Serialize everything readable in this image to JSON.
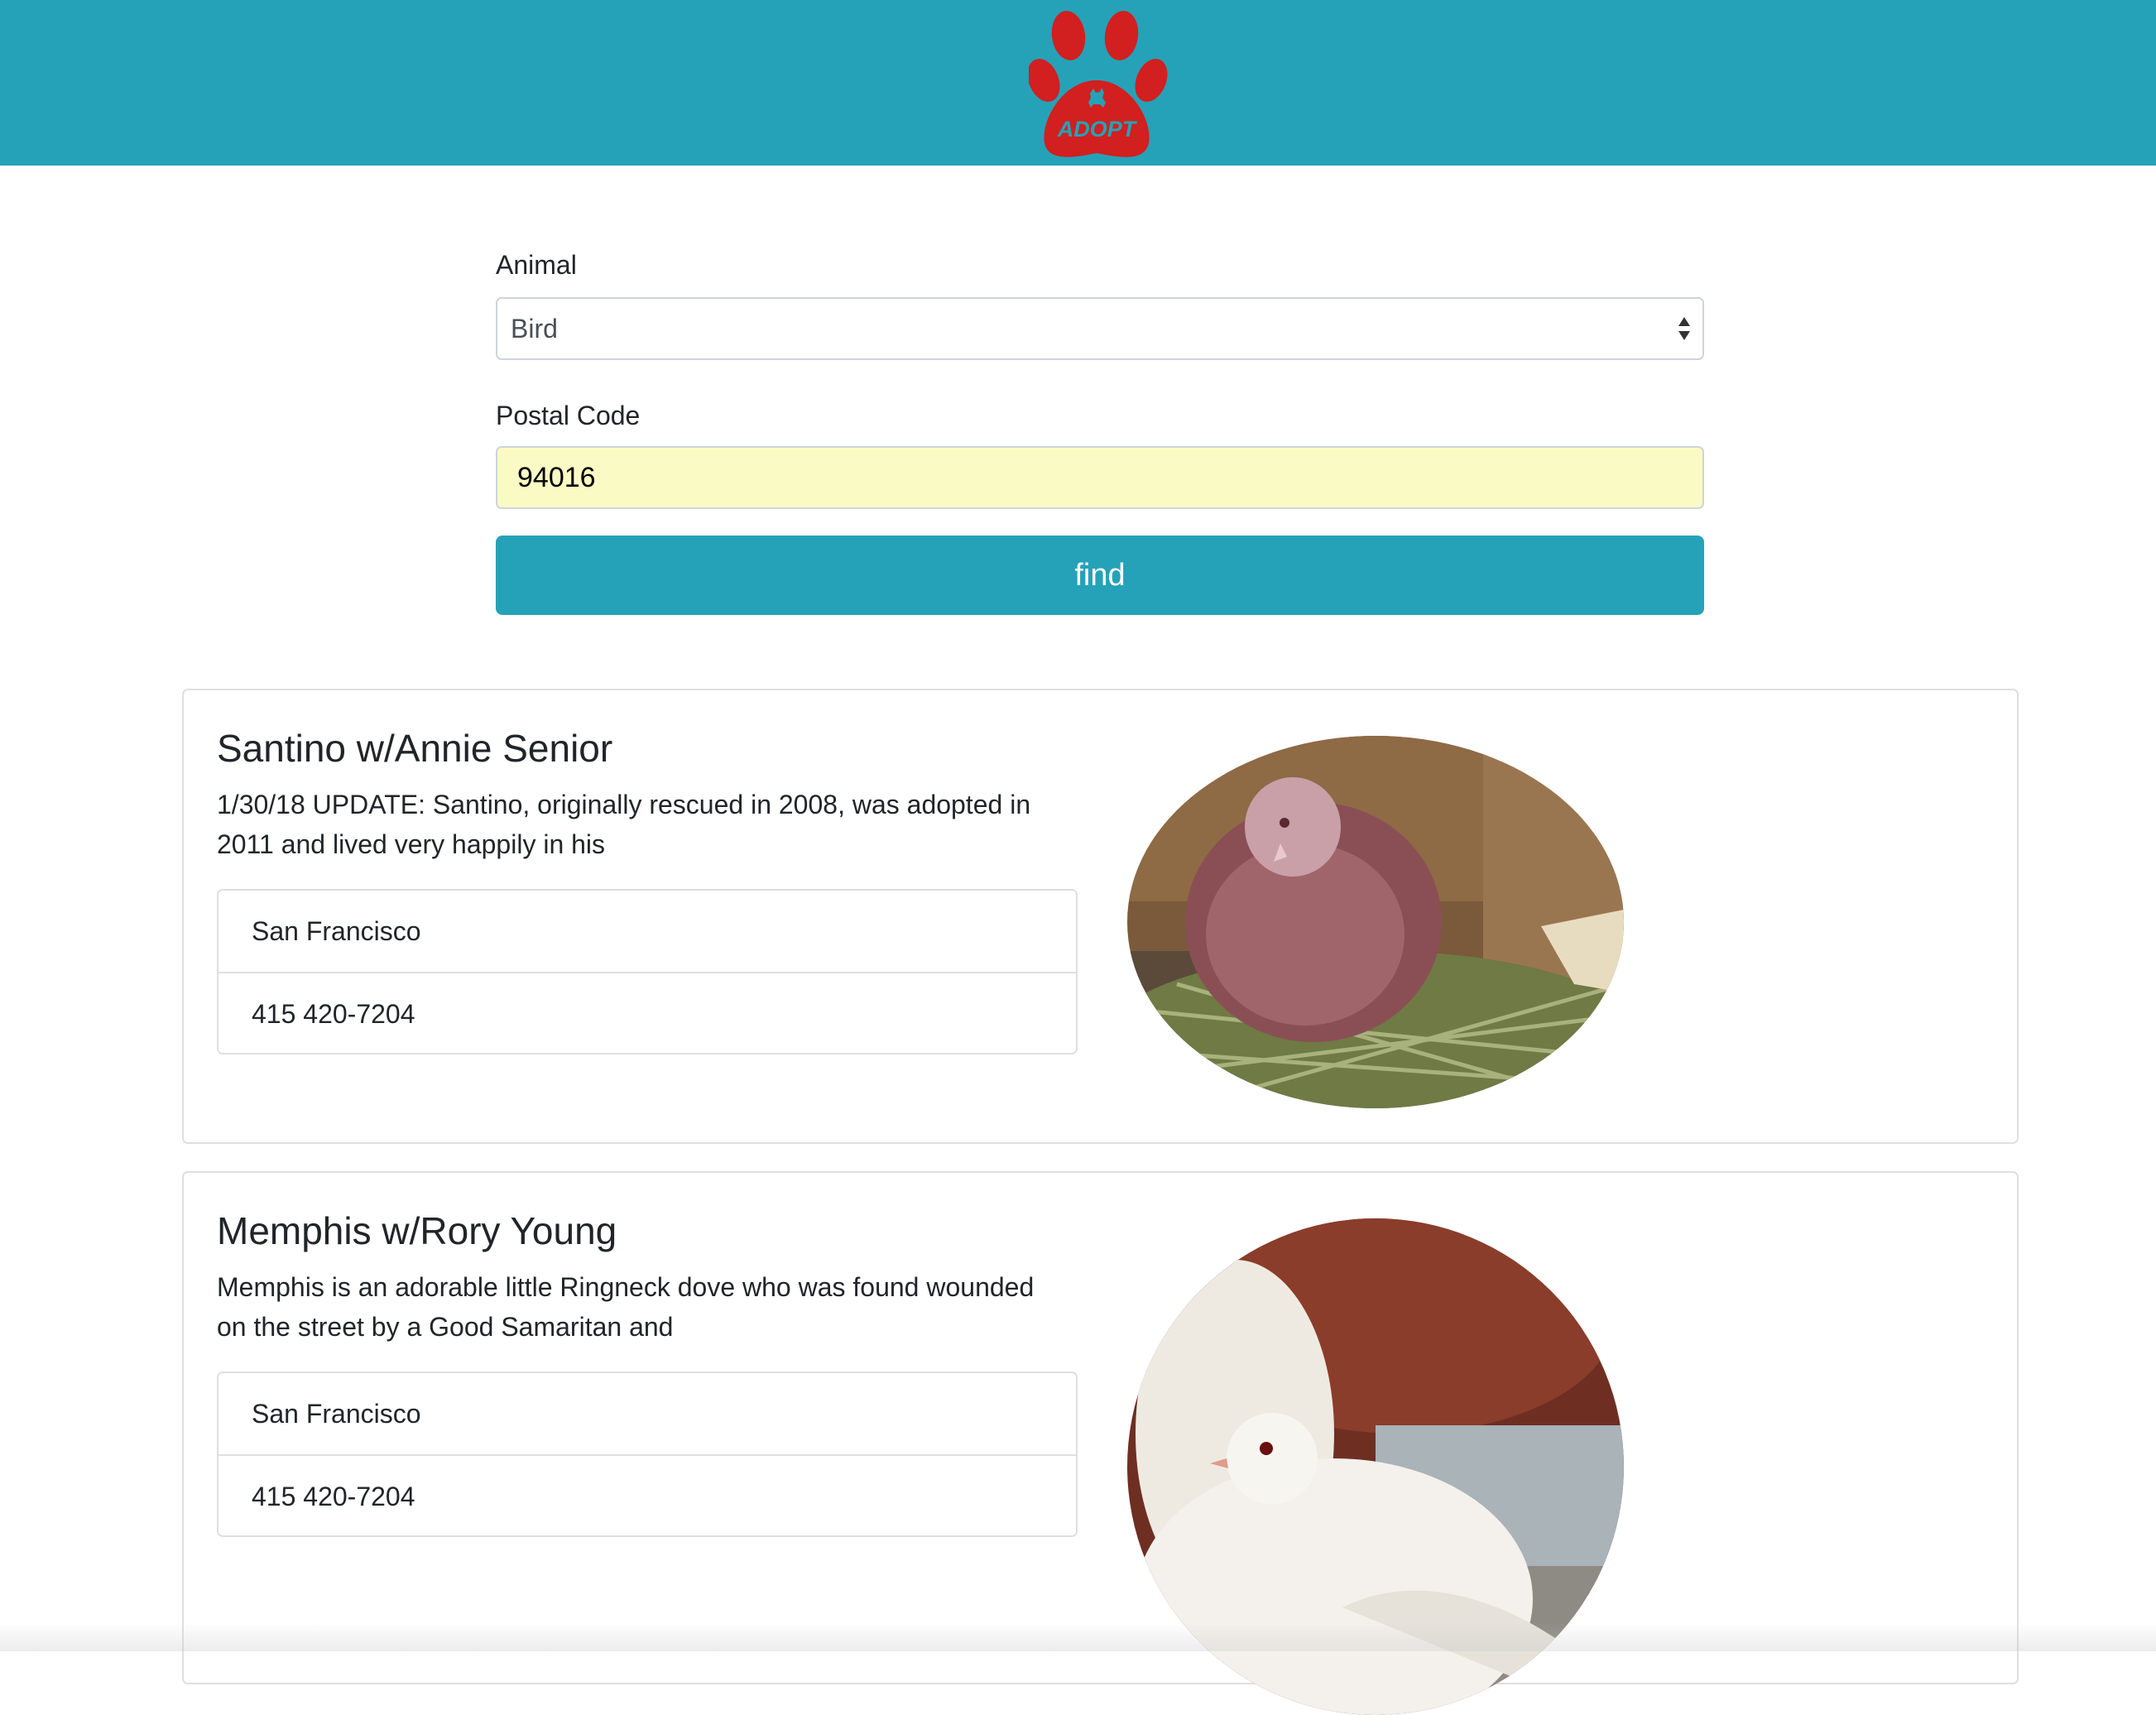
{
  "header": {
    "logo_text": "ADOPT",
    "background_color": "#25a2b8",
    "logo_color": "#d21f1f"
  },
  "search": {
    "animal_label": "Animal",
    "animal_value": "Bird",
    "postal_label": "Postal Code",
    "postal_value": "94016",
    "button_label": "find"
  },
  "results": [
    {
      "name": "Santino w/Annie Senior",
      "description": "1/30/18 UPDATE: Santino, originally rescued in 2008, was adopted in 2011 and lived very happily in his",
      "city": "San Francisco",
      "phone": "415 420-7204"
    },
    {
      "name": "Memphis w/Rory Young",
      "description": "Memphis is an adorable little Ringneck dove who was found wounded on the street by a Good Samaritan and",
      "city": "San Francisco",
      "phone": "415 420-7204"
    }
  ]
}
